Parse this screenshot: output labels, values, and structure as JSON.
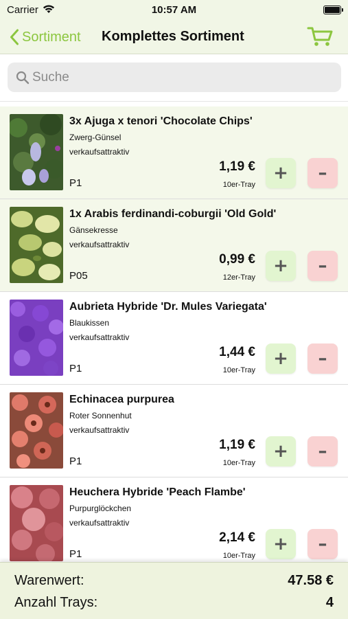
{
  "status": {
    "carrier": "Carrier",
    "time": "10:57 AM"
  },
  "nav": {
    "back_label": "Sortiment",
    "title": "Komplettes Sortiment",
    "accent_color": "#8cc63f"
  },
  "search": {
    "placeholder": "Suche",
    "value": ""
  },
  "products": [
    {
      "title": "3x Ajuga x tenori 'Chocolate Chips'",
      "common": "Zwerg-Günsel",
      "tag": "verkaufsattraktiv",
      "code": "P1",
      "price": "1,19 €",
      "unit": "10er-Tray",
      "plus": "+",
      "minus": "–",
      "highlight": true
    },
    {
      "title": "1x Arabis ferdinandi-coburgii 'Old Gold'",
      "common": "Gänsekresse",
      "tag": "verkaufsattraktiv",
      "code": "P05",
      "price": "0,99 €",
      "unit": "12er-Tray",
      "plus": "+",
      "minus": "–",
      "highlight": true
    },
    {
      "title": "Aubrieta Hybride 'Dr. Mules Variegata'",
      "common": "Blaukissen",
      "tag": "verkaufsattraktiv",
      "code": "P1",
      "price": "1,44 €",
      "unit": "10er-Tray",
      "plus": "+",
      "minus": "–",
      "highlight": false
    },
    {
      "title": "Echinacea purpurea",
      "common": "Roter Sonnenhut",
      "tag": "verkaufsattraktiv",
      "code": "P1",
      "price": "1,19 €",
      "unit": "10er-Tray",
      "plus": "+",
      "minus": "–",
      "highlight": false
    },
    {
      "title": "Heuchera Hybride 'Peach Flambe'",
      "common": "Purpurglöckchen",
      "tag": "verkaufsattraktiv",
      "code": "P1",
      "price": "2,14 €",
      "unit": "10er-Tray",
      "plus": "+",
      "minus": "–",
      "highlight": false
    }
  ],
  "footer": {
    "value_label": "Warenwert:",
    "value": "47.58 €",
    "trays_label": "Anzahl Trays:",
    "trays": "4"
  }
}
